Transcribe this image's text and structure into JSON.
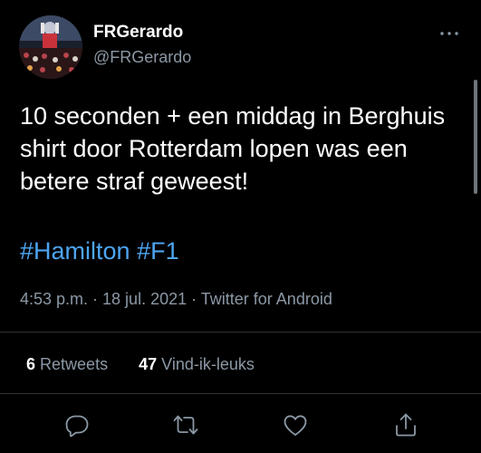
{
  "tweet": {
    "author": {
      "display_name": "FRGerardo",
      "handle": "@FRGerardo",
      "avatar": "avatar-photo"
    },
    "text": "10 seconden + een middag in Berghuis shirt door Rotterdam lopen was een betere straf geweest!",
    "hashtags": [
      "#Hamilton",
      "#F1"
    ],
    "timestamp": "4:53 p.m. · 18 jul. 2021 · Twitter for Android"
  },
  "stats": {
    "retweets_count": "6",
    "retweets_label": "Retweets",
    "likes_count": "47",
    "likes_label": "Vind-ik-leuks"
  },
  "icons": {
    "more": "more-horizontal-icon",
    "reply": "reply-icon",
    "retweet": "retweet-icon",
    "like": "heart-icon",
    "share": "share-icon"
  },
  "colors": {
    "background": "#000000",
    "text": "#ffffff",
    "secondary_text": "#8b98a5",
    "link": "#4ea5f1",
    "divider": "#2f3336"
  }
}
